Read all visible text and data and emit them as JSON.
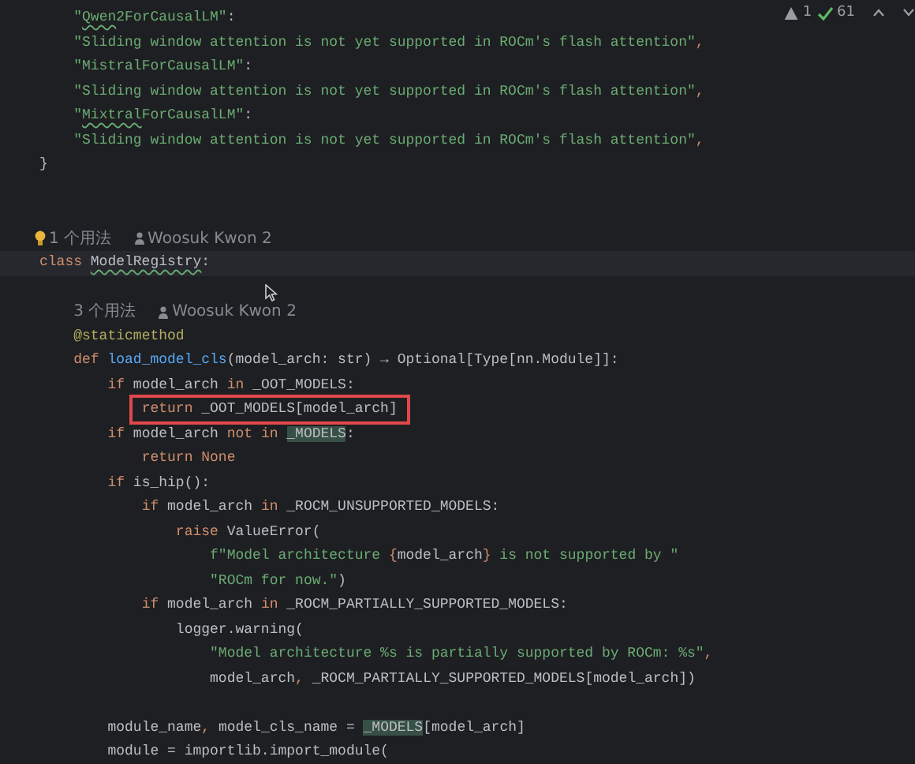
{
  "inspections": {
    "warnings": "1",
    "checks": "61"
  },
  "lines": [
    {
      "kind": "code",
      "tokens": [
        {
          "text": "    \"",
          "kind": "string"
        },
        {
          "text": "Qwen",
          "kind": "string",
          "typo": true
        },
        {
          "text": "2ForCausalLM\"",
          "kind": "string"
        },
        {
          "text": ":",
          "kind": "plain"
        }
      ]
    },
    {
      "kind": "code",
      "tokens": [
        {
          "text": "    \"Sliding window attention is not yet supported in ROCm's flash attention\"",
          "kind": "string"
        },
        {
          "text": ",",
          "kind": "punct"
        }
      ]
    },
    {
      "kind": "code",
      "tokens": [
        {
          "text": "    \"MistralForCausalLM\"",
          "kind": "string"
        },
        {
          "text": ":",
          "kind": "plain"
        }
      ]
    },
    {
      "kind": "code",
      "tokens": [
        {
          "text": "    \"Sliding window attention is not yet supported in ROCm's flash attention\"",
          "kind": "string"
        },
        {
          "text": ",",
          "kind": "punct"
        }
      ]
    },
    {
      "kind": "code",
      "tokens": [
        {
          "text": "    \"",
          "kind": "string"
        },
        {
          "text": "Mixtral",
          "kind": "string",
          "typo": true
        },
        {
          "text": "ForCausalLM\"",
          "kind": "string"
        },
        {
          "text": ":",
          "kind": "plain"
        }
      ]
    },
    {
      "kind": "code",
      "tokens": [
        {
          "text": "    \"Sliding window attention is not yet supported in ROCm's flash attention\"",
          "kind": "string"
        },
        {
          "text": ",",
          "kind": "punct"
        }
      ]
    },
    {
      "kind": "code",
      "tokens": [
        {
          "text": "}",
          "kind": "plain"
        }
      ]
    },
    {
      "kind": "blank"
    },
    {
      "kind": "blank"
    },
    {
      "kind": "inlay",
      "hints": [
        {
          "kind": "usages",
          "text": "1 个用法",
          "bulb": true
        },
        {
          "kind": "author",
          "text": "Woosuk Kwon 2"
        }
      ]
    },
    {
      "kind": "code",
      "current": true,
      "tokens": [
        {
          "text": "class ",
          "kind": "keyword"
        },
        {
          "text": "ModelRegistry",
          "kind": "plain",
          "typo": true
        },
        {
          "text": ":",
          "kind": "plain"
        }
      ]
    },
    {
      "kind": "blank"
    },
    {
      "kind": "inlay",
      "member": true,
      "hints": [
        {
          "kind": "usages",
          "text": "3 个用法",
          "bulb": false
        },
        {
          "kind": "author",
          "text": "Woosuk Kwon 2"
        }
      ]
    },
    {
      "kind": "code",
      "tokens": [
        {
          "text": "    @staticmethod",
          "kind": "decorator"
        }
      ]
    },
    {
      "kind": "code",
      "tokens": [
        {
          "text": "    def ",
          "kind": "keyword"
        },
        {
          "text": "load_model_cls",
          "kind": "function"
        },
        {
          "text": "(model_arch: str) → Optional[Type[nn.Module]]:",
          "kind": "plain"
        }
      ]
    },
    {
      "kind": "code",
      "tokens": [
        {
          "text": "        if ",
          "kind": "keyword"
        },
        {
          "text": "model_arch ",
          "kind": "plain"
        },
        {
          "text": "in ",
          "kind": "keyword"
        },
        {
          "text": "_OOT_MODELS:",
          "kind": "plain"
        }
      ]
    },
    {
      "kind": "code",
      "boxed": true,
      "tokens": [
        {
          "text": "            return ",
          "kind": "keyword"
        },
        {
          "text": "_OOT_MODELS[model_arch]",
          "kind": "plain"
        }
      ]
    },
    {
      "kind": "code",
      "tokens": [
        {
          "text": "        if ",
          "kind": "keyword"
        },
        {
          "text": "model_arch ",
          "kind": "plain"
        },
        {
          "text": "not in ",
          "kind": "keyword"
        },
        {
          "text": "_MODELS",
          "kind": "plain",
          "highlighted": true
        },
        {
          "text": ":",
          "kind": "plain"
        }
      ]
    },
    {
      "kind": "code",
      "tokens": [
        {
          "text": "            return None",
          "kind": "keyword"
        }
      ]
    },
    {
      "kind": "code",
      "tokens": [
        {
          "text": "        if ",
          "kind": "keyword"
        },
        {
          "text": "is_hip():",
          "kind": "plain"
        }
      ]
    },
    {
      "kind": "code",
      "tokens": [
        {
          "text": "            if ",
          "kind": "keyword"
        },
        {
          "text": "model_arch ",
          "kind": "plain"
        },
        {
          "text": "in ",
          "kind": "keyword"
        },
        {
          "text": "_ROCM_UNSUPPORTED_MODELS:",
          "kind": "plain"
        }
      ]
    },
    {
      "kind": "code",
      "tokens": [
        {
          "text": "                raise ",
          "kind": "keyword"
        },
        {
          "text": "ValueError(",
          "kind": "plain"
        }
      ]
    },
    {
      "kind": "code",
      "tokens": [
        {
          "text": "                    f\"Model architecture ",
          "kind": "string"
        },
        {
          "text": "{",
          "kind": "punct"
        },
        {
          "text": "model_arch",
          "kind": "plain"
        },
        {
          "text": "}",
          "kind": "punct"
        },
        {
          "text": " is not supported by \"",
          "kind": "string"
        }
      ]
    },
    {
      "kind": "code",
      "tokens": [
        {
          "text": "                    \"ROCm for now.\"",
          "kind": "string"
        },
        {
          "text": ")",
          "kind": "plain"
        }
      ]
    },
    {
      "kind": "code",
      "tokens": [
        {
          "text": "            if ",
          "kind": "keyword"
        },
        {
          "text": "model_arch ",
          "kind": "plain"
        },
        {
          "text": "in ",
          "kind": "keyword"
        },
        {
          "text": "_ROCM_PARTIALLY_SUPPORTED_MODELS:",
          "kind": "plain"
        }
      ]
    },
    {
      "kind": "code",
      "tokens": [
        {
          "text": "                logger.warning(",
          "kind": "plain"
        }
      ]
    },
    {
      "kind": "code",
      "tokens": [
        {
          "text": "                    \"Model architecture %s is partially supported by ROCm: %s\"",
          "kind": "string"
        },
        {
          "text": ",",
          "kind": "punct"
        }
      ]
    },
    {
      "kind": "code",
      "tokens": [
        {
          "text": "                    model_arch",
          "kind": "plain"
        },
        {
          "text": ", ",
          "kind": "punct"
        },
        {
          "text": "_ROCM_PARTIALLY_SUPPORTED_MODELS[model_arch])",
          "kind": "plain"
        }
      ]
    },
    {
      "kind": "blank"
    },
    {
      "kind": "code",
      "tokens": [
        {
          "text": "        module_name",
          "kind": "plain"
        },
        {
          "text": ", ",
          "kind": "punct"
        },
        {
          "text": "model_cls_name = ",
          "kind": "plain"
        },
        {
          "text": "_MODELS",
          "kind": "plain",
          "highlighted": true
        },
        {
          "text": "[model_arch]",
          "kind": "plain"
        }
      ]
    },
    {
      "kind": "code",
      "tokens": [
        {
          "text": "        module = importlib.import_module(",
          "kind": "plain"
        }
      ]
    }
  ]
}
